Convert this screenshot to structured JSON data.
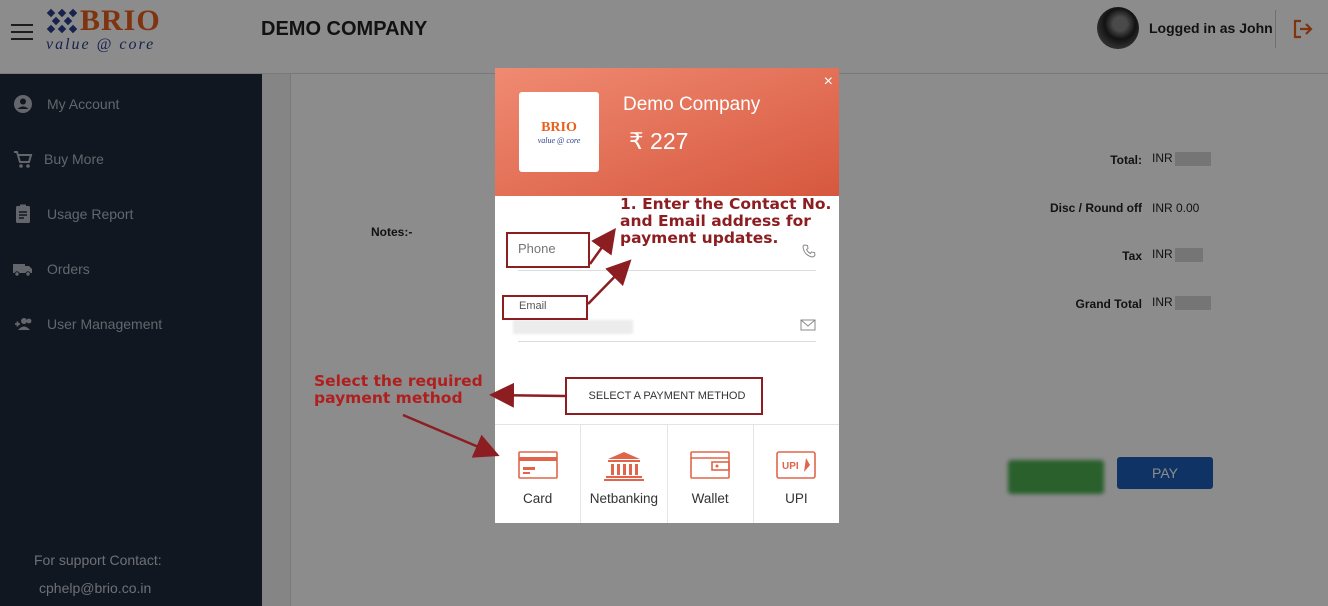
{
  "header": {
    "logo": {
      "brand": "BRIO",
      "tagline": "value @ core"
    },
    "company": "DEMO COMPANY",
    "user_label": "Logged in as John",
    "icons": {
      "menu": "hamburger-icon",
      "logout": "logout-icon"
    }
  },
  "sidebar": {
    "items": [
      {
        "label": "My Account",
        "icon": "account-circle-icon"
      },
      {
        "label": "Buy More",
        "icon": "cart-icon"
      },
      {
        "label": "Usage Report",
        "icon": "clipboard-icon"
      },
      {
        "label": "Orders",
        "icon": "truck-icon"
      },
      {
        "label": "User Management",
        "icon": "users-icon"
      }
    ],
    "support_title": "For support Contact:",
    "support_email": "cphelp@brio.co.in"
  },
  "summary": {
    "notes_label": "Notes:-",
    "rows": [
      {
        "label": "Total:",
        "value": "INR"
      },
      {
        "label": "Disc / Round off",
        "value": "INR 0.00"
      },
      {
        "label": "Tax",
        "value": "INR"
      },
      {
        "label": "Grand Total",
        "value": "INR"
      }
    ],
    "pay_label": "PAY"
  },
  "modal": {
    "merchant_logo": {
      "brand": "BRIO",
      "tagline": "value @ core"
    },
    "merchant_name": "Demo Company",
    "amount": "₹ 227",
    "close_label": "×",
    "phone_placeholder": "Phone",
    "email_label": "Email",
    "select_method": "SELECT A PAYMENT METHOD",
    "methods": [
      {
        "label": "Card",
        "icon": "card-icon"
      },
      {
        "label": "Netbanking",
        "icon": "bank-icon"
      },
      {
        "label": "Wallet",
        "icon": "wallet-icon"
      },
      {
        "label": "UPI",
        "icon": "upi-icon"
      }
    ]
  },
  "annotations": {
    "contact": [
      "1. Enter the Contact No.",
      "and Email address for",
      "payment updates."
    ],
    "method": [
      "Select the required",
      "payment method"
    ],
    "color": "#8c1e22"
  },
  "colors": {
    "accent": "#e8601c",
    "sidebar_bg": "#1f2a3d",
    "pay_button": "#1d5db8",
    "modal_header": "#e06c52"
  }
}
